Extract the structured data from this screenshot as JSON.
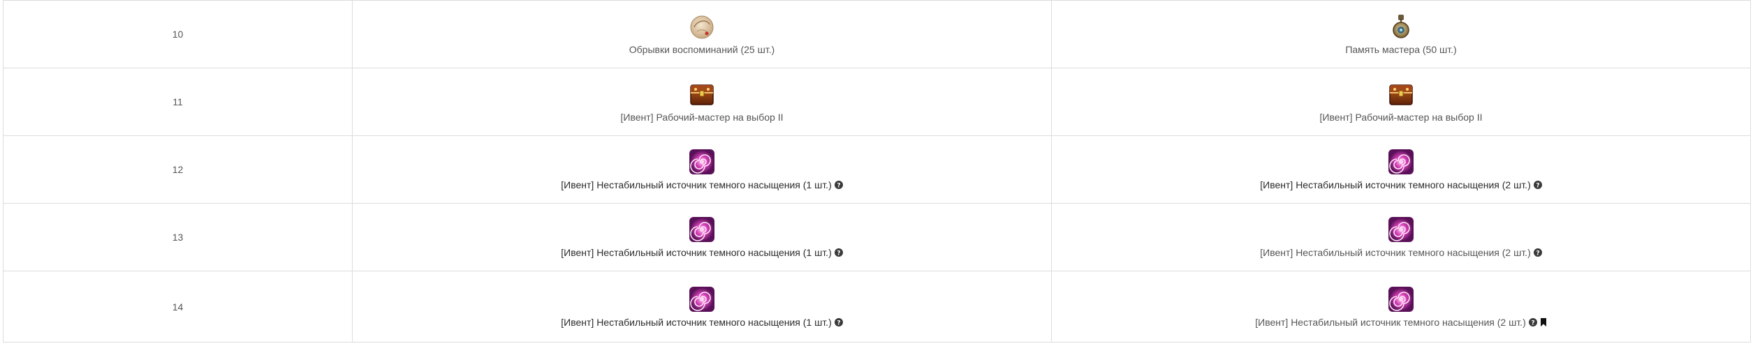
{
  "rows": [
    {
      "number": "10",
      "left": {
        "icon": "parchment-scroll-icon",
        "label": "Обрывки воспоминаний (25 шт.)"
      },
      "right": {
        "icon": "master-memory-amulet-icon",
        "label": "Память мастера (50 шт.)"
      }
    },
    {
      "number": "11",
      "left": {
        "icon": "treasure-chest-icon",
        "label": "[Ивент] Рабочий-мастер на выбор II"
      },
      "right": {
        "icon": "treasure-chest-icon",
        "label": "[Ивент] Рабочий-мастер на выбор II"
      }
    },
    {
      "number": "12",
      "left": {
        "icon": "dark-spiral-icon",
        "label": "[Ивент] Нестабильный источник темного насыщения (1 шт.)"
      },
      "right": {
        "icon": "dark-spiral-icon",
        "label": "[Ивент] Нестабильный источник темного насыщения (2 шт.)"
      }
    },
    {
      "number": "13",
      "left": {
        "icon": "dark-spiral-icon",
        "label": "[Ивент] Нестабильный источник темного насыщения (1 шт.)"
      },
      "right": {
        "icon": "dark-spiral-icon",
        "label": "[Ивент] Нестабильный источник темного насыщения (2 шт.)"
      }
    },
    {
      "number": "14",
      "left": {
        "icon": "dark-spiral-icon",
        "label": "[Ивент] Нестабильный источник темного насыщения (1 шт.)"
      },
      "right": {
        "icon": "dark-spiral-icon",
        "label": "[Ивент] Нестабильный источник темного насыщения (2 шт.)"
      }
    }
  ],
  "colors": {
    "border": "#dcdcdc",
    "text": "#555555",
    "text_dark": "#2b2b2b",
    "spiral_purple": "#b0168f",
    "chest_brown": "#8a3b12"
  }
}
